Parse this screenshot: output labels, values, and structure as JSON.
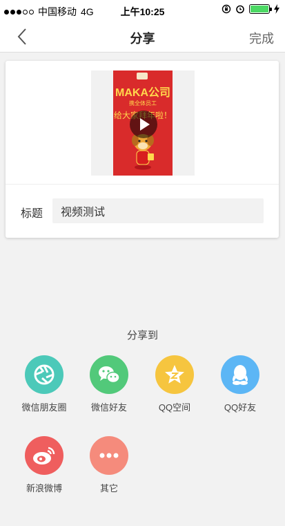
{
  "status_bar": {
    "carrier": "中国移动",
    "network": "4G",
    "time": "上午10:25"
  },
  "nav": {
    "title": "分享",
    "done_label": "完成"
  },
  "video": {
    "poster_brand": "MAKA公司",
    "poster_sub": "携全体员工",
    "poster_greeting": "给大家拜年啦！"
  },
  "title_field": {
    "label": "标题",
    "value": "视频测试"
  },
  "share": {
    "heading": "分享到",
    "items": [
      {
        "label": "微信朋友圈",
        "color": "#4cc9b9",
        "icon": "moments-icon"
      },
      {
        "label": "微信好友",
        "color": "#52c97a",
        "icon": "wechat-icon"
      },
      {
        "label": "QQ空间",
        "color": "#f6c53f",
        "icon": "qzone-icon"
      },
      {
        "label": "QQ好友",
        "color": "#5cb6f5",
        "icon": "qq-icon"
      },
      {
        "label": "新浪微博",
        "color": "#ef5e5e",
        "icon": "weibo-icon"
      },
      {
        "label": "其它",
        "color": "#f58b7c",
        "icon": "more-icon"
      }
    ]
  }
}
